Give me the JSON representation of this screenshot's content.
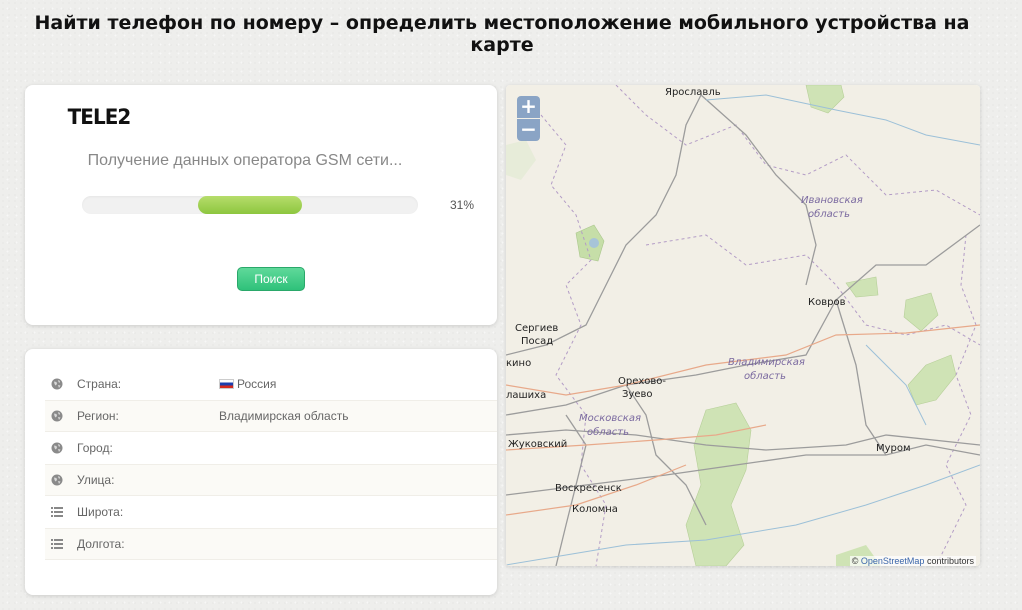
{
  "page": {
    "title": "Найти телефон по номеру – определить местоположение мобильного устройства на карте"
  },
  "search": {
    "logo": "TELE2",
    "status": "Получение данных оператора GSM сети...",
    "progress": 31,
    "progress_label": "31%",
    "button_label": "Поиск",
    "colors": {
      "progress": "#8dc63f",
      "button": "#2fc17a"
    }
  },
  "info": {
    "rows": [
      {
        "icon": "globe-icon",
        "label": "Страна:",
        "value": "Россия",
        "flag": "russia-flag"
      },
      {
        "icon": "globe-icon",
        "label": "Регион:",
        "value": "Владимирская область"
      },
      {
        "icon": "globe-icon",
        "label": "Город:",
        "value": ""
      },
      {
        "icon": "globe-icon",
        "label": "Улица:",
        "value": ""
      },
      {
        "icon": "list-icon",
        "label": "Широта:",
        "value": ""
      },
      {
        "icon": "list-icon",
        "label": "Долгота:",
        "value": ""
      }
    ]
  },
  "map": {
    "zoom_in": "+",
    "zoom_out": "−",
    "attribution_prefix": "©",
    "attribution_link": "OpenStreetMap",
    "attribution_suffix": "contributors",
    "cities": [
      "Ярославль",
      "Ковров",
      "Сергиев",
      "Посад",
      "Орехово-",
      "Зуево",
      "Жуковский",
      "Муром",
      "Воскресенск",
      "Коломна",
      "кино",
      "лашиха"
    ],
    "regions": [
      "Ивановская",
      "область",
      "Владимирская",
      "область",
      "Московская",
      "область"
    ]
  }
}
